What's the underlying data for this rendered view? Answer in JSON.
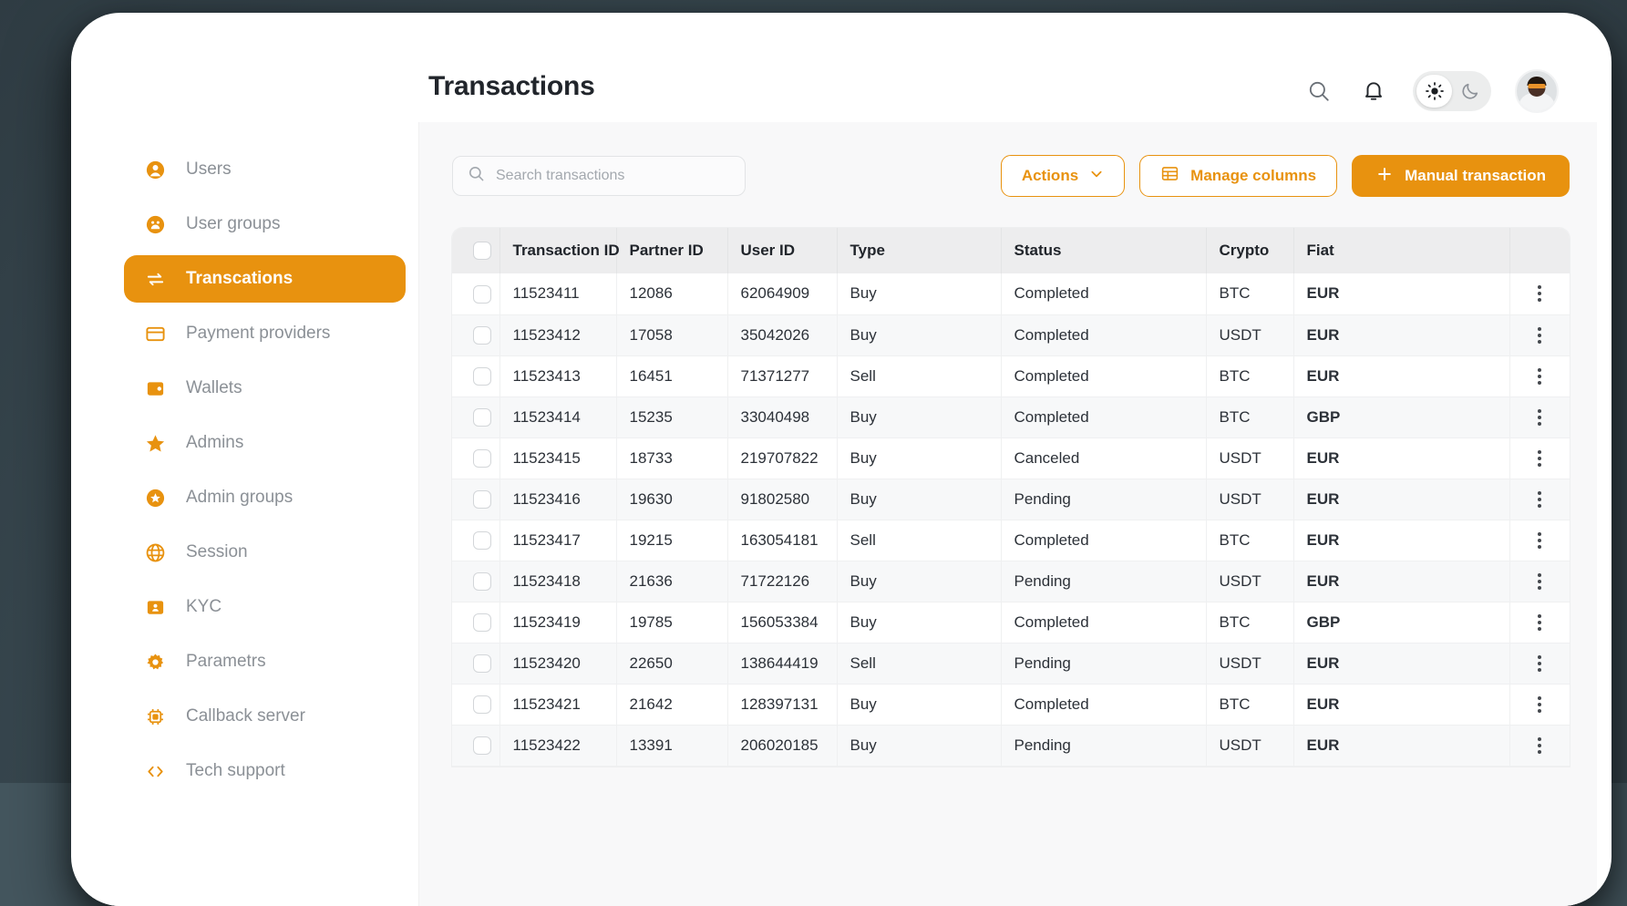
{
  "header": {
    "title": "Transactions",
    "icons": {
      "search": "search-icon",
      "notifications": "bell-icon",
      "theme_light": "sun-icon",
      "theme_dark": "moon-icon",
      "avatar": "user-avatar"
    },
    "theme_active": "light"
  },
  "sidebar": {
    "items": [
      {
        "label": "Users",
        "icon": "user-circle-icon",
        "active": false
      },
      {
        "label": "User groups",
        "icon": "users-group-icon",
        "active": false
      },
      {
        "label": "Transcations",
        "icon": "transfer-arrows-icon",
        "active": true
      },
      {
        "label": "Payment providers",
        "icon": "credit-card-icon",
        "active": false
      },
      {
        "label": "Wallets",
        "icon": "wallet-icon",
        "active": false
      },
      {
        "label": "Admins",
        "icon": "star-icon",
        "active": false
      },
      {
        "label": "Admin groups",
        "icon": "star-circle-icon",
        "active": false
      },
      {
        "label": "Session",
        "icon": "globe-icon",
        "active": false
      },
      {
        "label": "KYC",
        "icon": "id-card-icon",
        "active": false
      },
      {
        "label": "Parametrs",
        "icon": "gear-icon",
        "active": false
      },
      {
        "label": "Callback server",
        "icon": "chip-icon",
        "active": false
      },
      {
        "label": "Tech support",
        "icon": "code-brackets-icon",
        "active": false
      }
    ]
  },
  "toolbar": {
    "search_placeholder": "Search transactions",
    "search_value": "",
    "actions_label": "Actions",
    "manage_columns_label": "Manage columns",
    "manual_transaction_label": "Manual transaction"
  },
  "table": {
    "columns": [
      "Transaction ID",
      "Partner ID",
      "User ID",
      "Type",
      "Status",
      "Crypto",
      "Fiat"
    ],
    "rows": [
      {
        "id": "11523411",
        "partner": "12086",
        "user": "62064909",
        "type": "Buy",
        "status": "Completed",
        "crypto": "BTC",
        "fiat": "EUR"
      },
      {
        "id": "11523412",
        "partner": "17058",
        "user": "35042026",
        "type": "Buy",
        "status": "Completed",
        "crypto": "USDT",
        "fiat": "EUR"
      },
      {
        "id": "11523413",
        "partner": "16451",
        "user": "71371277",
        "type": "Sell",
        "status": "Completed",
        "crypto": "BTC",
        "fiat": "EUR"
      },
      {
        "id": "11523414",
        "partner": "15235",
        "user": "33040498",
        "type": "Buy",
        "status": "Completed",
        "crypto": "BTC",
        "fiat": "GBP"
      },
      {
        "id": "11523415",
        "partner": "18733",
        "user": "219707822",
        "type": "Buy",
        "status": "Canceled",
        "crypto": "USDT",
        "fiat": "EUR"
      },
      {
        "id": "11523416",
        "partner": "19630",
        "user": "91802580",
        "type": "Buy",
        "status": "Pending",
        "crypto": "USDT",
        "fiat": "EUR"
      },
      {
        "id": "11523417",
        "partner": "19215",
        "user": "163054181",
        "type": "Sell",
        "status": "Completed",
        "crypto": "BTC",
        "fiat": "EUR"
      },
      {
        "id": "11523418",
        "partner": "21636",
        "user": "71722126",
        "type": "Buy",
        "status": "Pending",
        "crypto": "USDT",
        "fiat": "EUR"
      },
      {
        "id": "11523419",
        "partner": "19785",
        "user": "156053384",
        "type": "Buy",
        "status": "Completed",
        "crypto": "BTC",
        "fiat": "GBP"
      },
      {
        "id": "11523420",
        "partner": "22650",
        "user": "138644419",
        "type": "Sell",
        "status": "Pending",
        "crypto": "USDT",
        "fiat": "EUR"
      },
      {
        "id": "11523421",
        "partner": "21642",
        "user": "128397131",
        "type": "Buy",
        "status": "Completed",
        "crypto": "BTC",
        "fiat": "EUR"
      },
      {
        "id": "11523422",
        "partner": "13391",
        "user": "206020185",
        "type": "Buy",
        "status": "Pending",
        "crypto": "USDT",
        "fiat": "EUR"
      }
    ],
    "row_menu_icon": "kebab-menu-icon"
  },
  "colors": {
    "accent": "#e8920f",
    "page_bg": "#f8f8f9",
    "header_bg": "#ededee",
    "text": "#21252b",
    "muted": "#8b9096"
  }
}
